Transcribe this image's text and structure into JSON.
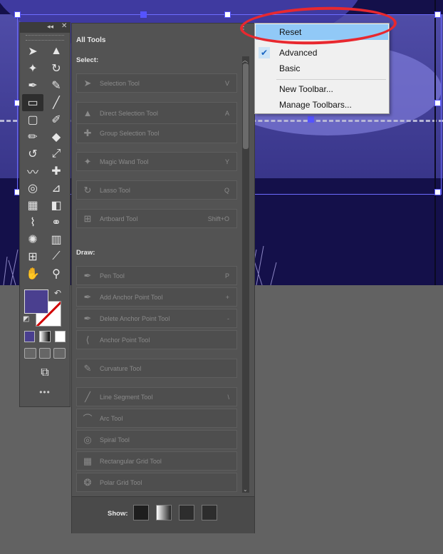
{
  "toolbar": {
    "collapse_icon": "double-chevron-icon",
    "close_icon": "close-icon",
    "fill_color": "#4a3f8f",
    "more_label": "•••"
  },
  "panel": {
    "title": "All Tools",
    "sections": [
      {
        "title": "Select:",
        "tools": [
          {
            "name": "Selection Tool",
            "key": "V",
            "icon": "selection-arrow-icon"
          },
          {
            "name": "Direct Selection Tool",
            "key": "A",
            "icon": "direct-selection-icon"
          },
          {
            "name": "Group Selection Tool",
            "key": "",
            "icon": "group-selection-icon"
          },
          {
            "name": "Magic Wand Tool",
            "key": "Y",
            "icon": "magic-wand-icon"
          },
          {
            "name": "Lasso Tool",
            "key": "Q",
            "icon": "lasso-icon"
          },
          {
            "name": "Artboard Tool",
            "key": "Shift+O",
            "icon": "artboard-icon"
          }
        ]
      },
      {
        "title": "Draw:",
        "tools": [
          {
            "name": "Pen Tool",
            "key": "P",
            "icon": "pen-icon"
          },
          {
            "name": "Add Anchor Point Tool",
            "key": "+",
            "icon": "add-anchor-icon"
          },
          {
            "name": "Delete Anchor Point Tool",
            "key": "-",
            "icon": "delete-anchor-icon"
          },
          {
            "name": "Anchor Point Tool",
            "key": "",
            "icon": "anchor-point-icon"
          },
          {
            "name": "Curvature Tool",
            "key": "",
            "icon": "curvature-icon"
          },
          {
            "name": "Line Segment Tool",
            "key": "\\",
            "icon": "line-segment-icon"
          },
          {
            "name": "Arc Tool",
            "key": "",
            "icon": "arc-icon"
          },
          {
            "name": "Spiral Tool",
            "key": "",
            "icon": "spiral-icon"
          },
          {
            "name": "Rectangular Grid Tool",
            "key": "",
            "icon": "rect-grid-icon"
          },
          {
            "name": "Polar Grid Tool",
            "key": "",
            "icon": "polar-grid-icon"
          }
        ]
      }
    ],
    "show_label": "Show:"
  },
  "menu": {
    "items": [
      {
        "label": "Reset",
        "highlighted": true
      },
      {
        "label": "Advanced",
        "checked": true
      },
      {
        "label": "Basic"
      },
      {
        "label": "New Toolbar..."
      },
      {
        "label": "Manage Toolbars..."
      }
    ]
  },
  "colors": {
    "highlight": "#91c9f7",
    "annotation": "#e8282f"
  }
}
